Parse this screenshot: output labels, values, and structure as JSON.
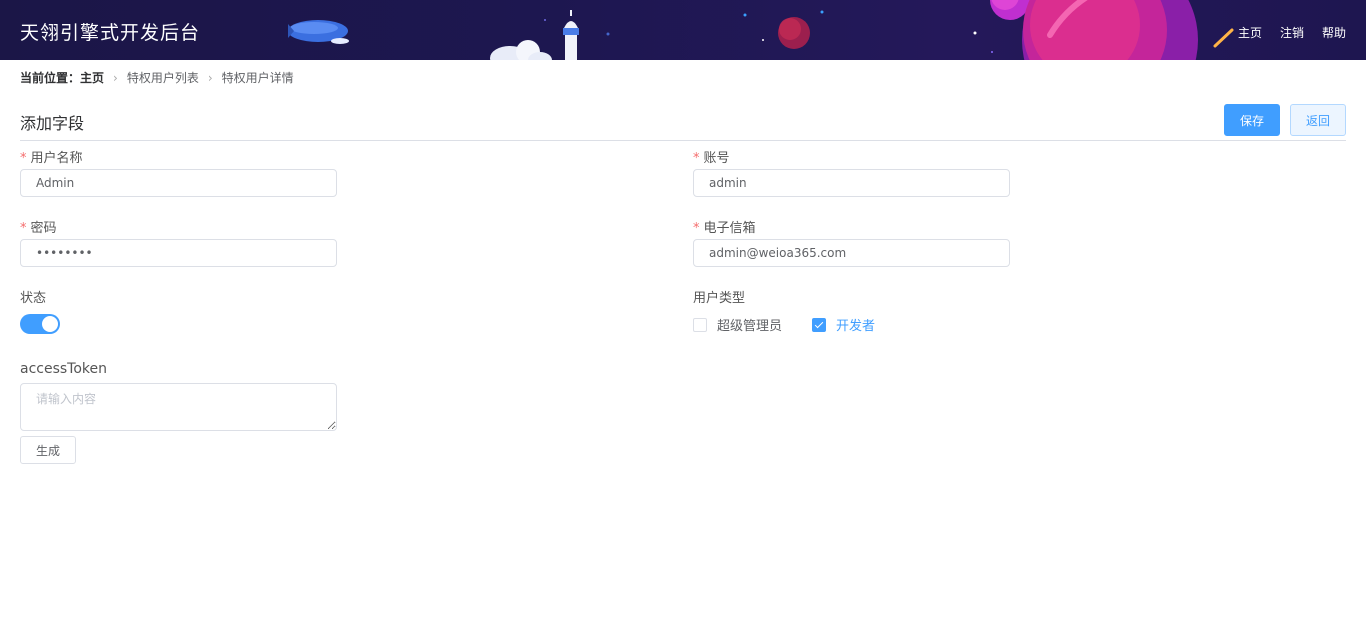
{
  "header": {
    "brand": "天翎引擎式开发后台",
    "nav": [
      "主页",
      "注销",
      "帮助"
    ]
  },
  "breadcrumb": {
    "prefix": "当前位置：",
    "items": [
      "主页",
      "特权用户列表",
      "特权用户详情"
    ]
  },
  "section": {
    "title": "添加字段",
    "save_label": "保存",
    "back_label": "返回"
  },
  "form": {
    "username": {
      "label": "用户名称",
      "value": "Admin",
      "required": true
    },
    "account": {
      "label": "账号",
      "value": "admin",
      "required": true
    },
    "password": {
      "label": "密码",
      "value": "••••••••",
      "required": true
    },
    "email": {
      "label": "电子信箱",
      "value": "admin@weioa365.com",
      "required": true
    },
    "status": {
      "label": "状态",
      "on": true
    },
    "user_type": {
      "label": "用户类型",
      "options": [
        {
          "label": "超级管理员",
          "checked": false
        },
        {
          "label": "开发者",
          "checked": true
        }
      ]
    },
    "access_token": {
      "label": "accessToken",
      "placeholder": "请输入内容",
      "value": ""
    },
    "generate_label": "生成"
  },
  "colors": {
    "primary": "#409eff",
    "header_bg": "#1d1750",
    "required": "#f56c6c"
  }
}
